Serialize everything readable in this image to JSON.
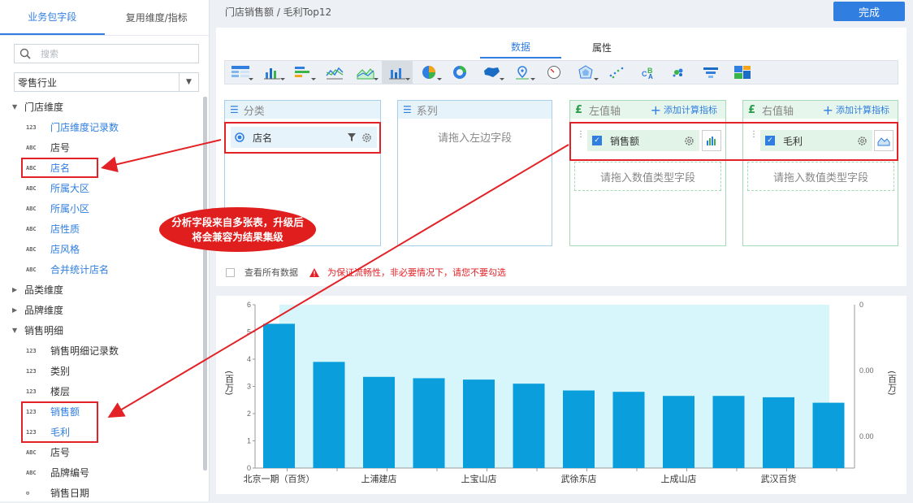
{
  "sidebar": {
    "tabs": [
      "业务包字段",
      "复用维度/指标"
    ],
    "search_placeholder": "搜索",
    "package_select": "零售行业",
    "tree": [
      {
        "kind": "group",
        "label": "门店维度",
        "expanded": true
      },
      {
        "kind": "field",
        "type": "123",
        "label": "门店维度记录数",
        "blue": true
      },
      {
        "kind": "field",
        "type": "ABC",
        "label": "店号",
        "blue": false
      },
      {
        "kind": "field",
        "type": "ABC",
        "label": "店名",
        "blue": true
      },
      {
        "kind": "field",
        "type": "ABC",
        "label": "所属大区",
        "blue": true
      },
      {
        "kind": "field",
        "type": "ABC",
        "label": "所属小区",
        "blue": true
      },
      {
        "kind": "field",
        "type": "ABC",
        "label": "店性质",
        "blue": true
      },
      {
        "kind": "field",
        "type": "ABC",
        "label": "店风格",
        "blue": true
      },
      {
        "kind": "field",
        "type": "ABC",
        "label": "合并统计店名",
        "blue": true
      },
      {
        "kind": "group",
        "label": "品类维度",
        "expanded": false
      },
      {
        "kind": "group",
        "label": "品牌维度",
        "expanded": false
      },
      {
        "kind": "group",
        "label": "销售明细",
        "expanded": true
      },
      {
        "kind": "field",
        "type": "123",
        "label": "销售明细记录数",
        "blue": false
      },
      {
        "kind": "field",
        "type": "123",
        "label": "类别",
        "blue": false
      },
      {
        "kind": "field",
        "type": "123",
        "label": "楼层",
        "blue": false
      },
      {
        "kind": "field",
        "type": "123",
        "label": "销售额",
        "blue": true
      },
      {
        "kind": "field",
        "type": "123",
        "label": "毛利",
        "blue": true
      },
      {
        "kind": "field",
        "type": "ABC",
        "label": "店号",
        "blue": false
      },
      {
        "kind": "field",
        "type": "ABC",
        "label": "品牌编号",
        "blue": false
      },
      {
        "kind": "field",
        "type": "⊙",
        "label": "销售日期",
        "blue": false
      }
    ]
  },
  "header": {
    "breadcrumb": "门店销售额 / 毛利Top12",
    "done_label": "完成"
  },
  "editor": {
    "tabs": [
      "数据",
      "属性"
    ],
    "active_tab": "数据",
    "chart_types": [
      "grouped-table-icon",
      "bar-chart-icon",
      "horizontal-bar-icon",
      "line-chart-icon",
      "area-chart-icon",
      "combo-chart-icon",
      "pie-chart-icon",
      "donut-chart-icon",
      "map-chart-icon",
      "point-map-icon",
      "gauge-icon",
      "radar-icon",
      "scatter-icon",
      "bubble-icon",
      "force-bubble-icon",
      "funnel-icon",
      "rect-tree-icon"
    ],
    "category": {
      "title": "分类",
      "field": "店名"
    },
    "series": {
      "title": "系列",
      "hint": "请拖入左边字段"
    },
    "left_axis": {
      "title": "左值轴",
      "add_label": "添加计算指标",
      "field": "销售额",
      "drop_hint": "请拖入数值类型字段"
    },
    "right_axis": {
      "title": "右值轴",
      "add_label": "添加计算指标",
      "field": "毛利",
      "drop_hint": "请拖入数值类型字段"
    },
    "view_all_label": "查看所有数据",
    "warning_text": "为保证流畅性，非必要情况下，请您不要勾选"
  },
  "callout": "分析字段来自多张表，升级后将会兼容为结果集级",
  "colors": {
    "accent": "#2f7ee0",
    "bar": "#0a9fdc",
    "plot_bg": "#d6f6fb",
    "annotation": "#e32227"
  },
  "chart_data": {
    "type": "bar",
    "categories": [
      "北京一期（百货）",
      "",
      "上浦建店",
      "",
      "上宝山店",
      "",
      "武徐东店",
      "",
      "上成山店",
      "",
      "武汉百货",
      ""
    ],
    "values": [
      5.3,
      3.9,
      3.35,
      3.3,
      3.25,
      3.1,
      2.85,
      2.8,
      2.65,
      2.65,
      2.6,
      2.4
    ],
    "ylabel": "(百万)",
    "y2label": "(百万)",
    "ylim": [
      0,
      6
    ],
    "yticks": [
      "0",
      "1",
      "2",
      "3",
      "4",
      "5",
      "6"
    ],
    "y2ticks": [
      "0",
      "0.00",
      "0.00"
    ]
  }
}
